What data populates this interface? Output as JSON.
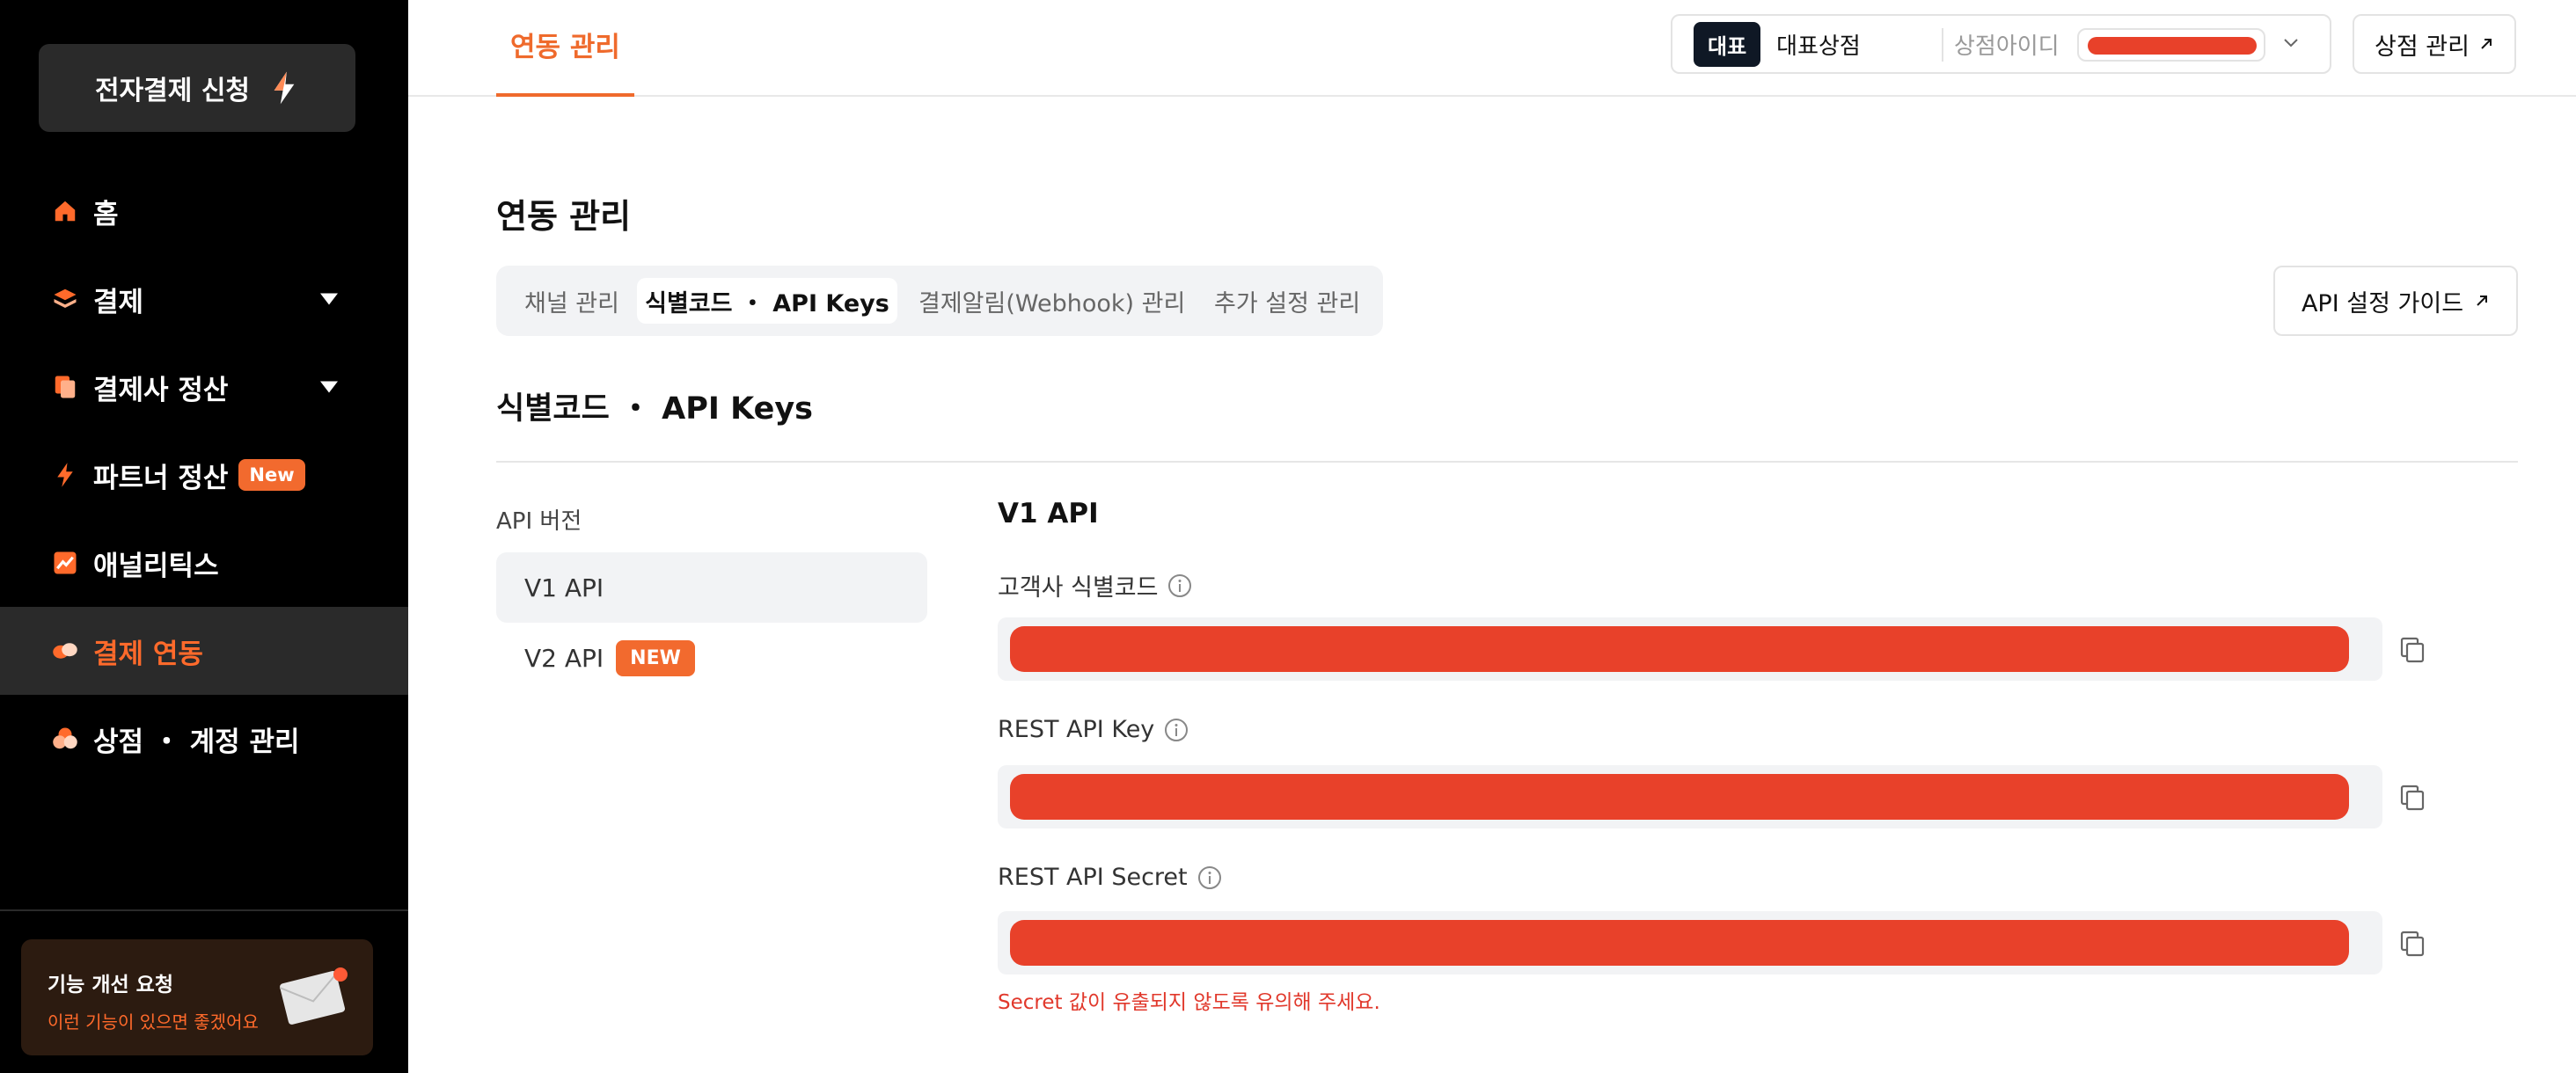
{
  "sidebar": {
    "apply_button": "전자결제 신청",
    "items": [
      {
        "label": "홈",
        "icon": "home-icon"
      },
      {
        "label": "결제",
        "icon": "layers-icon",
        "has_caret": true
      },
      {
        "label": "결제사 정산",
        "icon": "documents-icon",
        "has_caret": true
      },
      {
        "label": "파트너 정산",
        "icon": "bolt-icon",
        "badge": "New"
      },
      {
        "label": "애널리틱스",
        "icon": "chart-icon"
      },
      {
        "label": "결제 연동",
        "icon": "link-icon",
        "active": true
      },
      {
        "label": "상점 ・ 계정 관리",
        "icon": "store-icon"
      }
    ],
    "feedback": {
      "title": "기능 개선 요청",
      "subtitle": "이런 기능이 있으면 좋겠어요"
    }
  },
  "topbar": {
    "active_tab": "연동 관리",
    "store": {
      "badge": "대표",
      "name": "대표상점",
      "id_label": "상점아이디"
    },
    "manage_button": "상점 관리"
  },
  "main": {
    "page_title": "연동 관리",
    "tabs": [
      {
        "label": "채널 관리"
      },
      {
        "label": "식별코드 ・ API Keys",
        "active": true
      },
      {
        "label": "결제알림(Webhook) 관리"
      },
      {
        "label": "추가 설정 관리"
      }
    ],
    "guide_button": "API 설정 가이드",
    "section_title": "식별코드 ・ API Keys",
    "version_label": "API 버전",
    "versions": [
      {
        "label": "V1 API",
        "active": true
      },
      {
        "label": "V2 API",
        "badge": "NEW"
      }
    ],
    "api_title": "V1 API",
    "fields": [
      {
        "label": "고객사 식별코드"
      },
      {
        "label": "REST API Key"
      },
      {
        "label": "REST API Secret"
      }
    ],
    "secret_warning": "Secret 값이 유출되지 않도록 유의해 주세요."
  },
  "colors": {
    "accent": "#ef6a2c",
    "redacted": "#e8412a",
    "sidebar_bg": "#000000",
    "warning": "#e1382b"
  }
}
